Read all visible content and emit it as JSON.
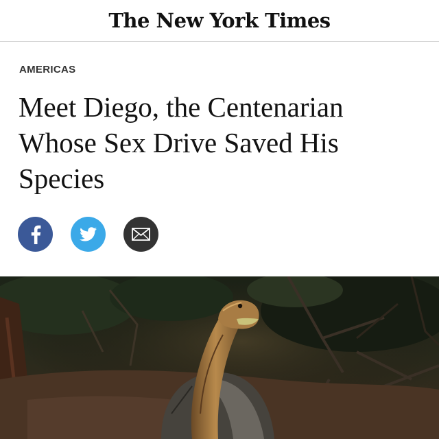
{
  "masthead": {
    "title": "The New York Times"
  },
  "article": {
    "section": "AMERICAS",
    "headline": "Meet Diego, the Centenarian Whose Sex Drive Saved His Species"
  },
  "share": {
    "buttons": [
      {
        "icon": "facebook-icon",
        "color": "#3b5998"
      },
      {
        "icon": "twitter-icon",
        "color": "#3ba9e8"
      },
      {
        "icon": "email-icon",
        "color": "#333333"
      }
    ]
  },
  "colors": {
    "text": "#121212",
    "section_label": "#333333",
    "divider": "#d7d7d7"
  }
}
